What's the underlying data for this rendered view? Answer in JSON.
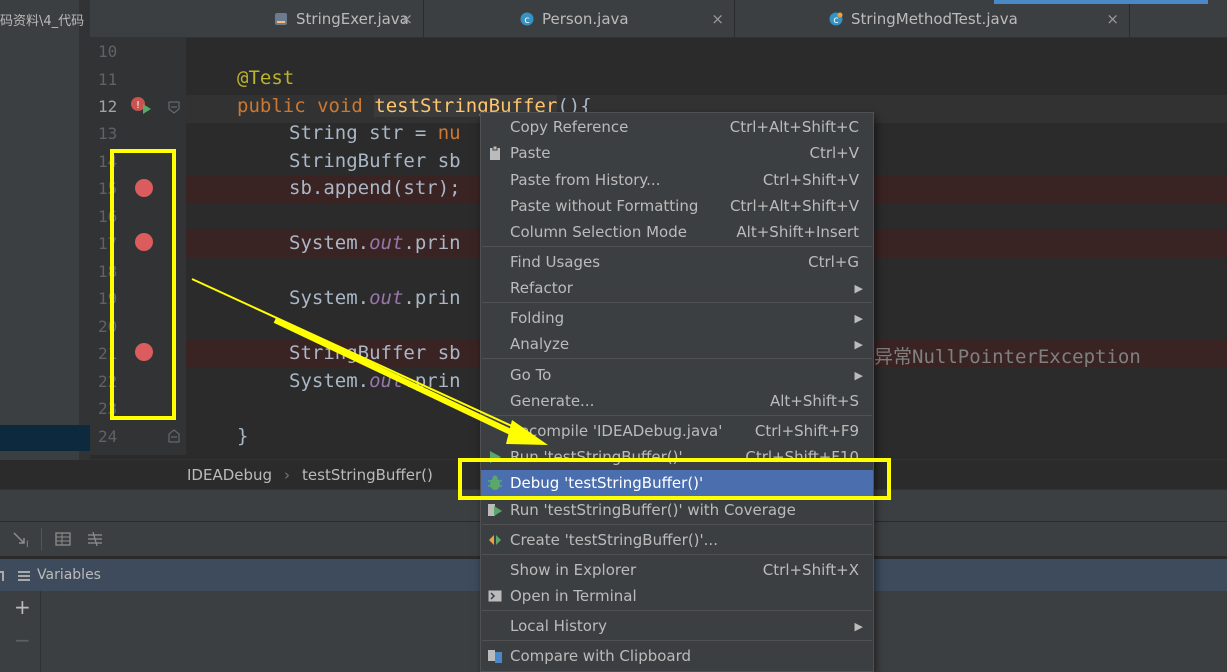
{
  "project_path_fragment": "码资料\\4_代码",
  "tabs": [
    {
      "label": "StringExer.java",
      "close": "×"
    },
    {
      "label": "Person.java",
      "close": "×"
    },
    {
      "label": "StringMethodTest.java",
      "close": "×"
    }
  ],
  "line_numbers": [
    "10",
    "11",
    "12",
    "13",
    "14",
    "15",
    "16",
    "17",
    "18",
    "19",
    "20",
    "21",
    "22",
    "23",
    "24"
  ],
  "code": {
    "l11_annotation": "@Test",
    "l12_public": "public ",
    "l12_void": "void ",
    "l12_method": "testStringBuffer",
    "l12_rest": "(){",
    "l13": "String str = ",
    "l13_kw": "nu",
    "l14": "StringBuffer sb",
    "l15": "sb.append(str);",
    "l17_a": "System.",
    "l17_b": "out",
    "l17_c": ".prin",
    "l19_a": "System.",
    "l19_b": "out",
    "l19_c": ".prin",
    "l21_a": "StringBuffer sb",
    "l21_comment": "异常NullPointerException",
    "l22_a": "System.",
    "l22_b": "out",
    "l22_c": ".prin",
    "l24": "}"
  },
  "breadcrumbs": {
    "item1": "IDEADebug",
    "sep": "›",
    "item2": "testStringBuffer()"
  },
  "bottom": {
    "variables_label": "Variables",
    "plus": "+",
    "minus": "−"
  },
  "context_menu": [
    {
      "label": "Copy Reference",
      "shortcut": "Ctrl+Alt+Shift+C"
    },
    {
      "label": "Paste",
      "shortcut": "Ctrl+V",
      "icon": "clipboard-icon"
    },
    {
      "label": "Paste from History...",
      "shortcut": "Ctrl+Shift+V"
    },
    {
      "label": "Paste without Formatting",
      "shortcut": "Ctrl+Alt+Shift+V"
    },
    {
      "label": "Column Selection Mode",
      "shortcut": "Alt+Shift+Insert"
    },
    {
      "label": "Find Usages",
      "shortcut": "Ctrl+G"
    },
    {
      "label": "Refactor",
      "submenu": "▶"
    },
    {
      "label": "Folding",
      "submenu": "▶"
    },
    {
      "label": "Analyze",
      "submenu": "▶"
    },
    {
      "label": "Go To",
      "submenu": "▶"
    },
    {
      "label": "Generate...",
      "shortcut": "Alt+Shift+S"
    },
    {
      "label": "Recompile 'IDEADebug.java'",
      "shortcut": "Ctrl+Shift+F9"
    },
    {
      "label": "Run 'testStringBuffer()'",
      "shortcut": "Ctrl+Shift+F10",
      "icon": "run-icon"
    },
    {
      "label": "Debug 'testStringBuffer()'",
      "icon": "debug-bug-icon"
    },
    {
      "label": "Run 'testStringBuffer()' with Coverage",
      "icon": "coverage-icon"
    },
    {
      "label": "Create 'testStringBuffer()'...",
      "icon": "create-config-icon"
    },
    {
      "label": "Show in Explorer",
      "shortcut": "Ctrl+Shift+X"
    },
    {
      "label": "Open in Terminal",
      "icon": "terminal-icon"
    },
    {
      "label": "Local History",
      "submenu": "▶"
    },
    {
      "label": "Compare with Clipboard",
      "icon": "compare-icon"
    }
  ],
  "colors": {
    "breakpoint": "#db5c5c",
    "annotation_highlight": "#ffff00",
    "menu_selected": "#4b6eaf"
  }
}
